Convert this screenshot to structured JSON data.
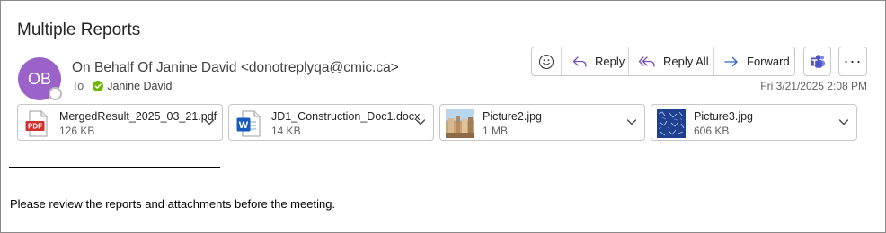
{
  "email": {
    "subject": "Multiple Reports",
    "avatar_initials": "OB",
    "from": "On Behalf Of Janine David <donotreplyqa@cmic.ca>",
    "to_label": "To",
    "to_name": "Janine David",
    "date": "Fri 3/21/2025 2:08 PM",
    "body": "Please review the reports and attachments before the meeting."
  },
  "actions": {
    "emoji_icon": "smiley-icon",
    "reply": "Reply",
    "reply_all": "Reply All",
    "forward": "Forward",
    "teams_icon": "teams-icon",
    "more": "···"
  },
  "attachments": [
    {
      "name": "MergedResult_2025_03_21.pdf",
      "size": "126 KB",
      "icon": "pdf-icon"
    },
    {
      "name": "JD1_Construction_Doc1.docx",
      "size": "14 KB",
      "icon": "word-icon"
    },
    {
      "name": "Picture2.jpg",
      "size": "1 MB",
      "icon": "image-thumbnail"
    },
    {
      "name": "Picture3.jpg",
      "size": "606 KB",
      "icon": "image-thumbnail"
    }
  ],
  "colors": {
    "avatar": "#9b63c9",
    "reply_accent": "#7a4fb5",
    "forward_accent": "#2b66c4",
    "pdf_red": "#d32f2f",
    "word_blue": "#185abd"
  }
}
